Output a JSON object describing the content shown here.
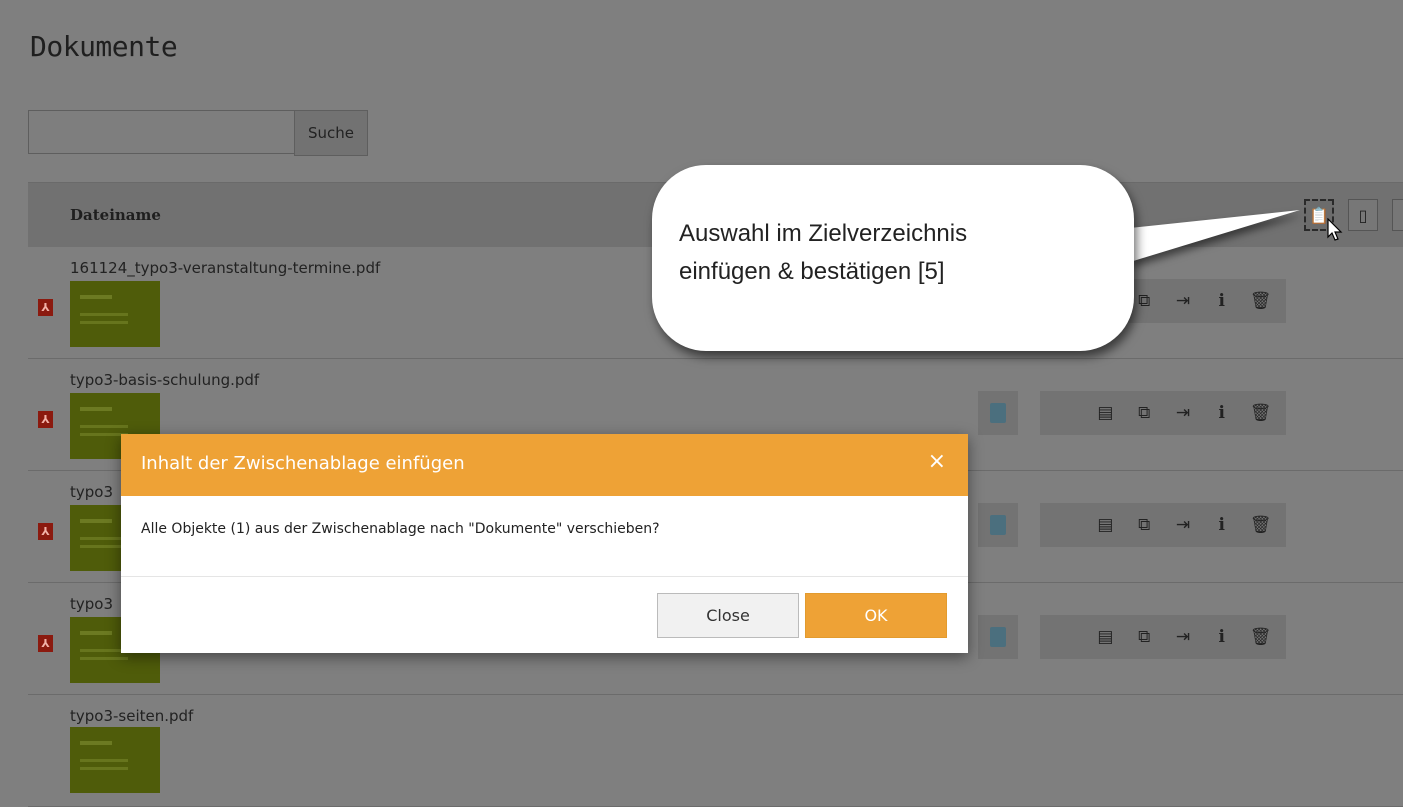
{
  "page": {
    "title": "Dokumente"
  },
  "search": {
    "button_label": "Suche",
    "value": "",
    "placeholder": ""
  },
  "table": {
    "column_header": "Dateiname",
    "header_icons": [
      "paste-into-icon",
      "clipboard-icon"
    ],
    "rows": [
      {
        "filename": "161124_typo3-veranstaltung-termine.pdf"
      },
      {
        "filename": "typo3-basis-schulung.pdf"
      },
      {
        "filename": "typo3"
      },
      {
        "filename": "typo3"
      },
      {
        "filename": "typo3-seiten.pdf"
      }
    ],
    "row_action_icons": [
      "metadata-icon",
      "copy-icon",
      "rename-icon",
      "info-icon",
      "delete-icon"
    ]
  },
  "dialog": {
    "title": "Inhalt der Zwischenablage einfügen",
    "close_symbol": "×",
    "message": "Alle Objekte (1) aus der Zwischenablage nach \"Dokumente\" verschieben?",
    "close_button": "Close",
    "ok_button": "OK",
    "accent_color": "#eea236"
  },
  "callout": {
    "line1": "Auswahl im Zielverzeichnis",
    "line2": "einfügen & bestätigen [5]"
  }
}
